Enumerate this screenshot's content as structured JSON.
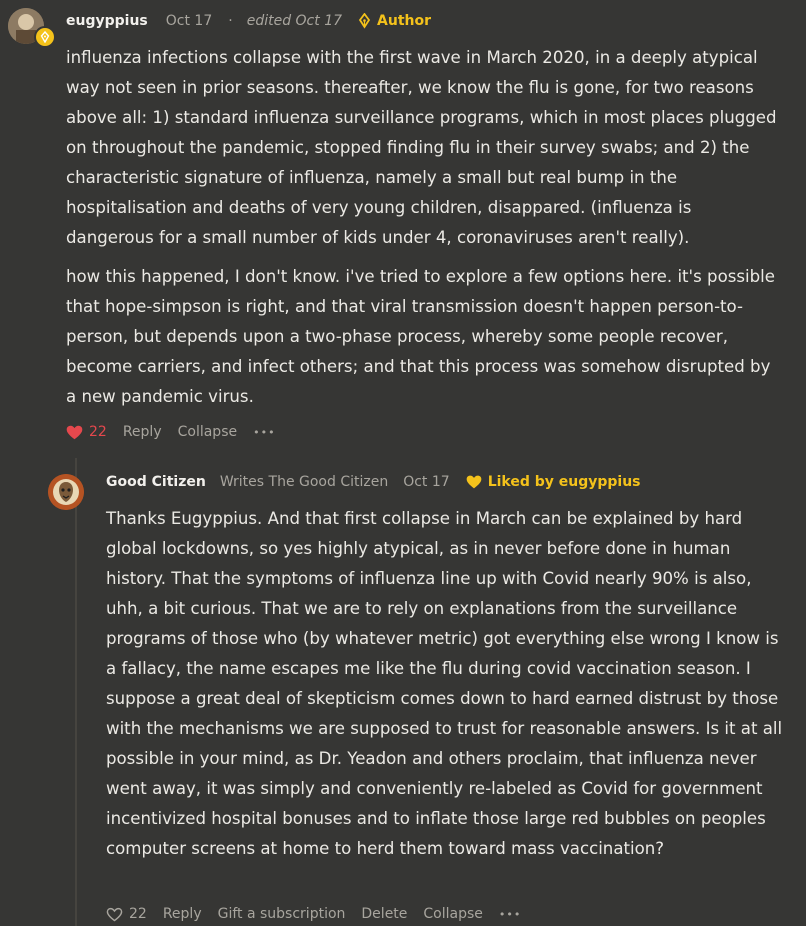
{
  "comments": [
    {
      "author": "eugyppius",
      "date": "Oct 17",
      "separator": "·",
      "edited": "edited Oct 17",
      "badge": "Author",
      "paragraphs": [
        "influenza infections collapse with the first wave in March 2020, in a deeply atypical way not seen in prior seasons. thereafter, we know the flu is gone, for two reasons above all: 1) standard influenza surveillance programs, which in most places plugged on throughout the pandemic, stopped finding flu in their survey swabs; and 2) the characteristic signature of influenza, namely a small but real bump in the hospitalisation and deaths of very young children, disappared. (influenza is dangerous for a small number of kids under 4, coronaviruses aren't really).",
        "how this happened, I don't know. i've tried to explore a few options here. it's possible that hope-simpson is right, and that viral transmission doesn't happen person-to-person, but depends upon a two-phase process, whereby some people recover, become carriers, and infect others; and that this process was somehow disrupted by a new pandemic virus."
      ],
      "likes": "22",
      "liked": true,
      "actions": [
        "Reply",
        "Collapse"
      ],
      "more": "•••"
    },
    {
      "author": "Good Citizen",
      "writes": "Writes The Good Citizen",
      "date": "Oct 17",
      "liked_by": "Liked by eugyppius",
      "paragraphs": [
        "Thanks Eugyppius. And that first collapse in March can be explained by hard global lockdowns, so yes highly atypical, as in never before done in human history. That the symptoms of influenza line up with Covid nearly 90% is also, uhh, a bit curious. That we are to rely on explanations from the surveillance programs of those who (by whatever metric) got everything else wrong I know is a fallacy, the name escapes me like the flu during covid vaccination season. I suppose a great deal of skepticism comes down to hard earned distrust by those with the mechanisms we are supposed to trust for reasonable answers. Is it at all possible in your mind, as Dr. Yeadon and others proclaim, that influenza never went away, it was simply and conveniently re-labeled as Covid for government incentivized hospital bonuses and to inflate those large red bubbles on peoples computer screens at home to herd them toward mass vaccination?"
      ],
      "likes": "22",
      "liked": false,
      "actions": [
        "Reply",
        "Gift a subscription",
        "Delete",
        "Collapse"
      ],
      "more": "•••"
    }
  ],
  "icons": {
    "pen": "fountain-pen-icon",
    "heart": "heart-icon",
    "more": "more-dots-icon"
  },
  "colors": {
    "background": "#363634",
    "accent": "#f4c21b",
    "like_red": "#e5484d",
    "muted": "#a8a59e"
  }
}
